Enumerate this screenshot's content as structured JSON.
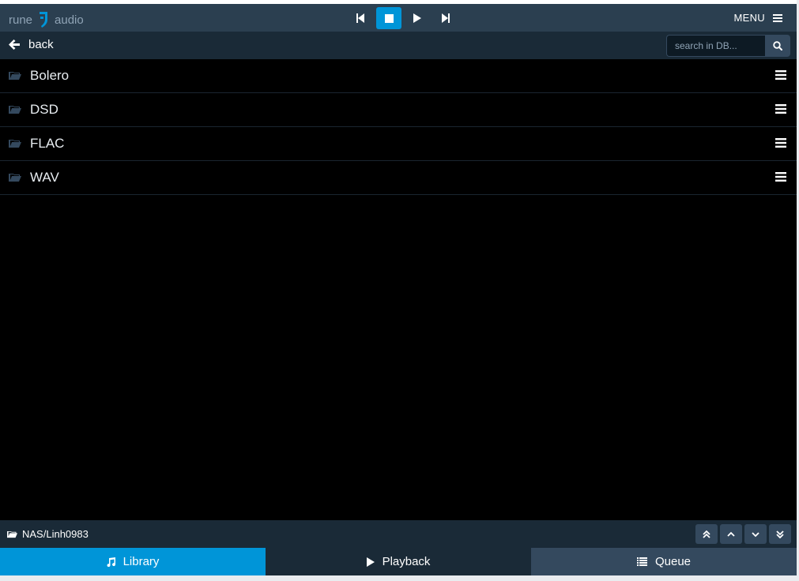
{
  "app": {
    "logo_left": "rune",
    "logo_right": "audio"
  },
  "header": {
    "menu_label": "MENU"
  },
  "subbar": {
    "back_label": "back",
    "search_placeholder": "search in DB..."
  },
  "library": {
    "items": [
      {
        "label": "Bolero"
      },
      {
        "label": "DSD"
      },
      {
        "label": "FLAC"
      },
      {
        "label": "WAV"
      }
    ]
  },
  "footer": {
    "path": "NAS/Linh0983"
  },
  "tabs": [
    {
      "label": "Library",
      "icon": "music-note-icon"
    },
    {
      "label": "Playback",
      "icon": "play-icon"
    },
    {
      "label": "Queue",
      "icon": "list-icon"
    }
  ],
  "colors": {
    "accent": "#0095d8",
    "topbar": "#2b3f50",
    "subbar": "#1a2a37",
    "button": "#34495e"
  }
}
